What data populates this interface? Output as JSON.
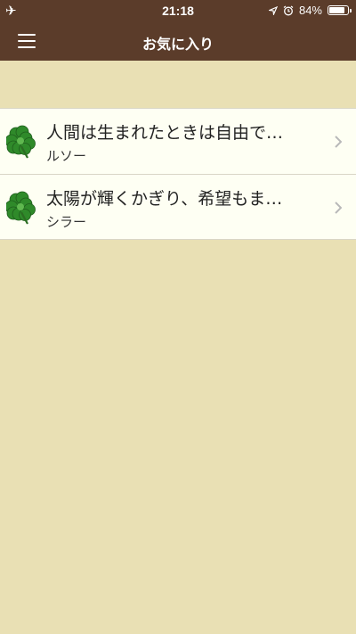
{
  "status_bar": {
    "time": "21:18",
    "battery_text": "84%",
    "battery_level": 0.84,
    "icons": [
      "airplane-icon",
      "location-arrow-icon",
      "alarm-icon",
      "battery-icon"
    ]
  },
  "nav": {
    "title": "お気に入り",
    "menu_icon": "hamburger-menu-icon"
  },
  "favorites": [
    {
      "title": "人間は生まれたときは自由で…",
      "author": "ルソー",
      "icon": "four-leaf-clover-icon"
    },
    {
      "title": "太陽が輝くかぎり、希望もま…",
      "author": "シラー",
      "icon": "four-leaf-clover-icon"
    }
  ],
  "colors": {
    "header": "#5b3c2a",
    "background": "#e9e0b4",
    "row": "#fefff3",
    "clover": "#2f8a2a"
  }
}
